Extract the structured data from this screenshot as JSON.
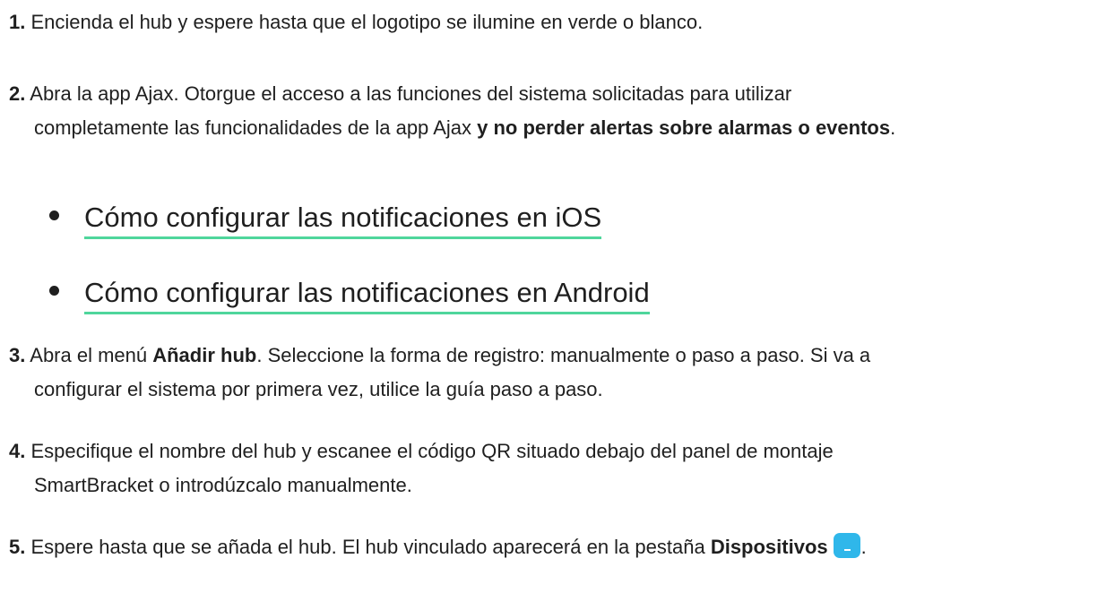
{
  "steps": [
    {
      "num": "1.",
      "text": "Encienda el hub y espere hasta que el logotipo se ilumine en verde o blanco."
    },
    {
      "num": "2.",
      "line1": "Abra la app Ajax. Otorgue el acceso a las funciones del sistema solicitadas para utilizar",
      "line2": "completamente las funcionalidades de la app Ajax ",
      "bold": "y no perder alertas sobre alarmas o eventos",
      "end": "."
    },
    {
      "num": "3.",
      "before": "Abra el menú ",
      "bold": "Añadir hub",
      "after": ". Seleccione la forma de registro: manualmente o paso a paso. Si va a",
      "line2": "configurar el sistema por primera vez, utilice la guía paso a paso."
    },
    {
      "num": "4.",
      "line1": "Especifique el nombre del hub y escanee el código QR situado debajo del panel de montaje",
      "line2": "SmartBracket o introdúzcalo manualmente."
    },
    {
      "num": "5.",
      "before": "Espere hasta que se añada el hub. El hub vinculado aparecerá en la pestaña ",
      "bold": "Dispositivos",
      "end": "."
    }
  ],
  "links": [
    {
      "label": "Cómo configurar las notificaciones en iOS"
    },
    {
      "label": "Cómo configurar las notificaciones en Android"
    }
  ],
  "colors": {
    "link_underline": "#4fd69c",
    "devices_icon": "#2fb7ea"
  },
  "icons": {
    "devices": "devices-icon"
  }
}
